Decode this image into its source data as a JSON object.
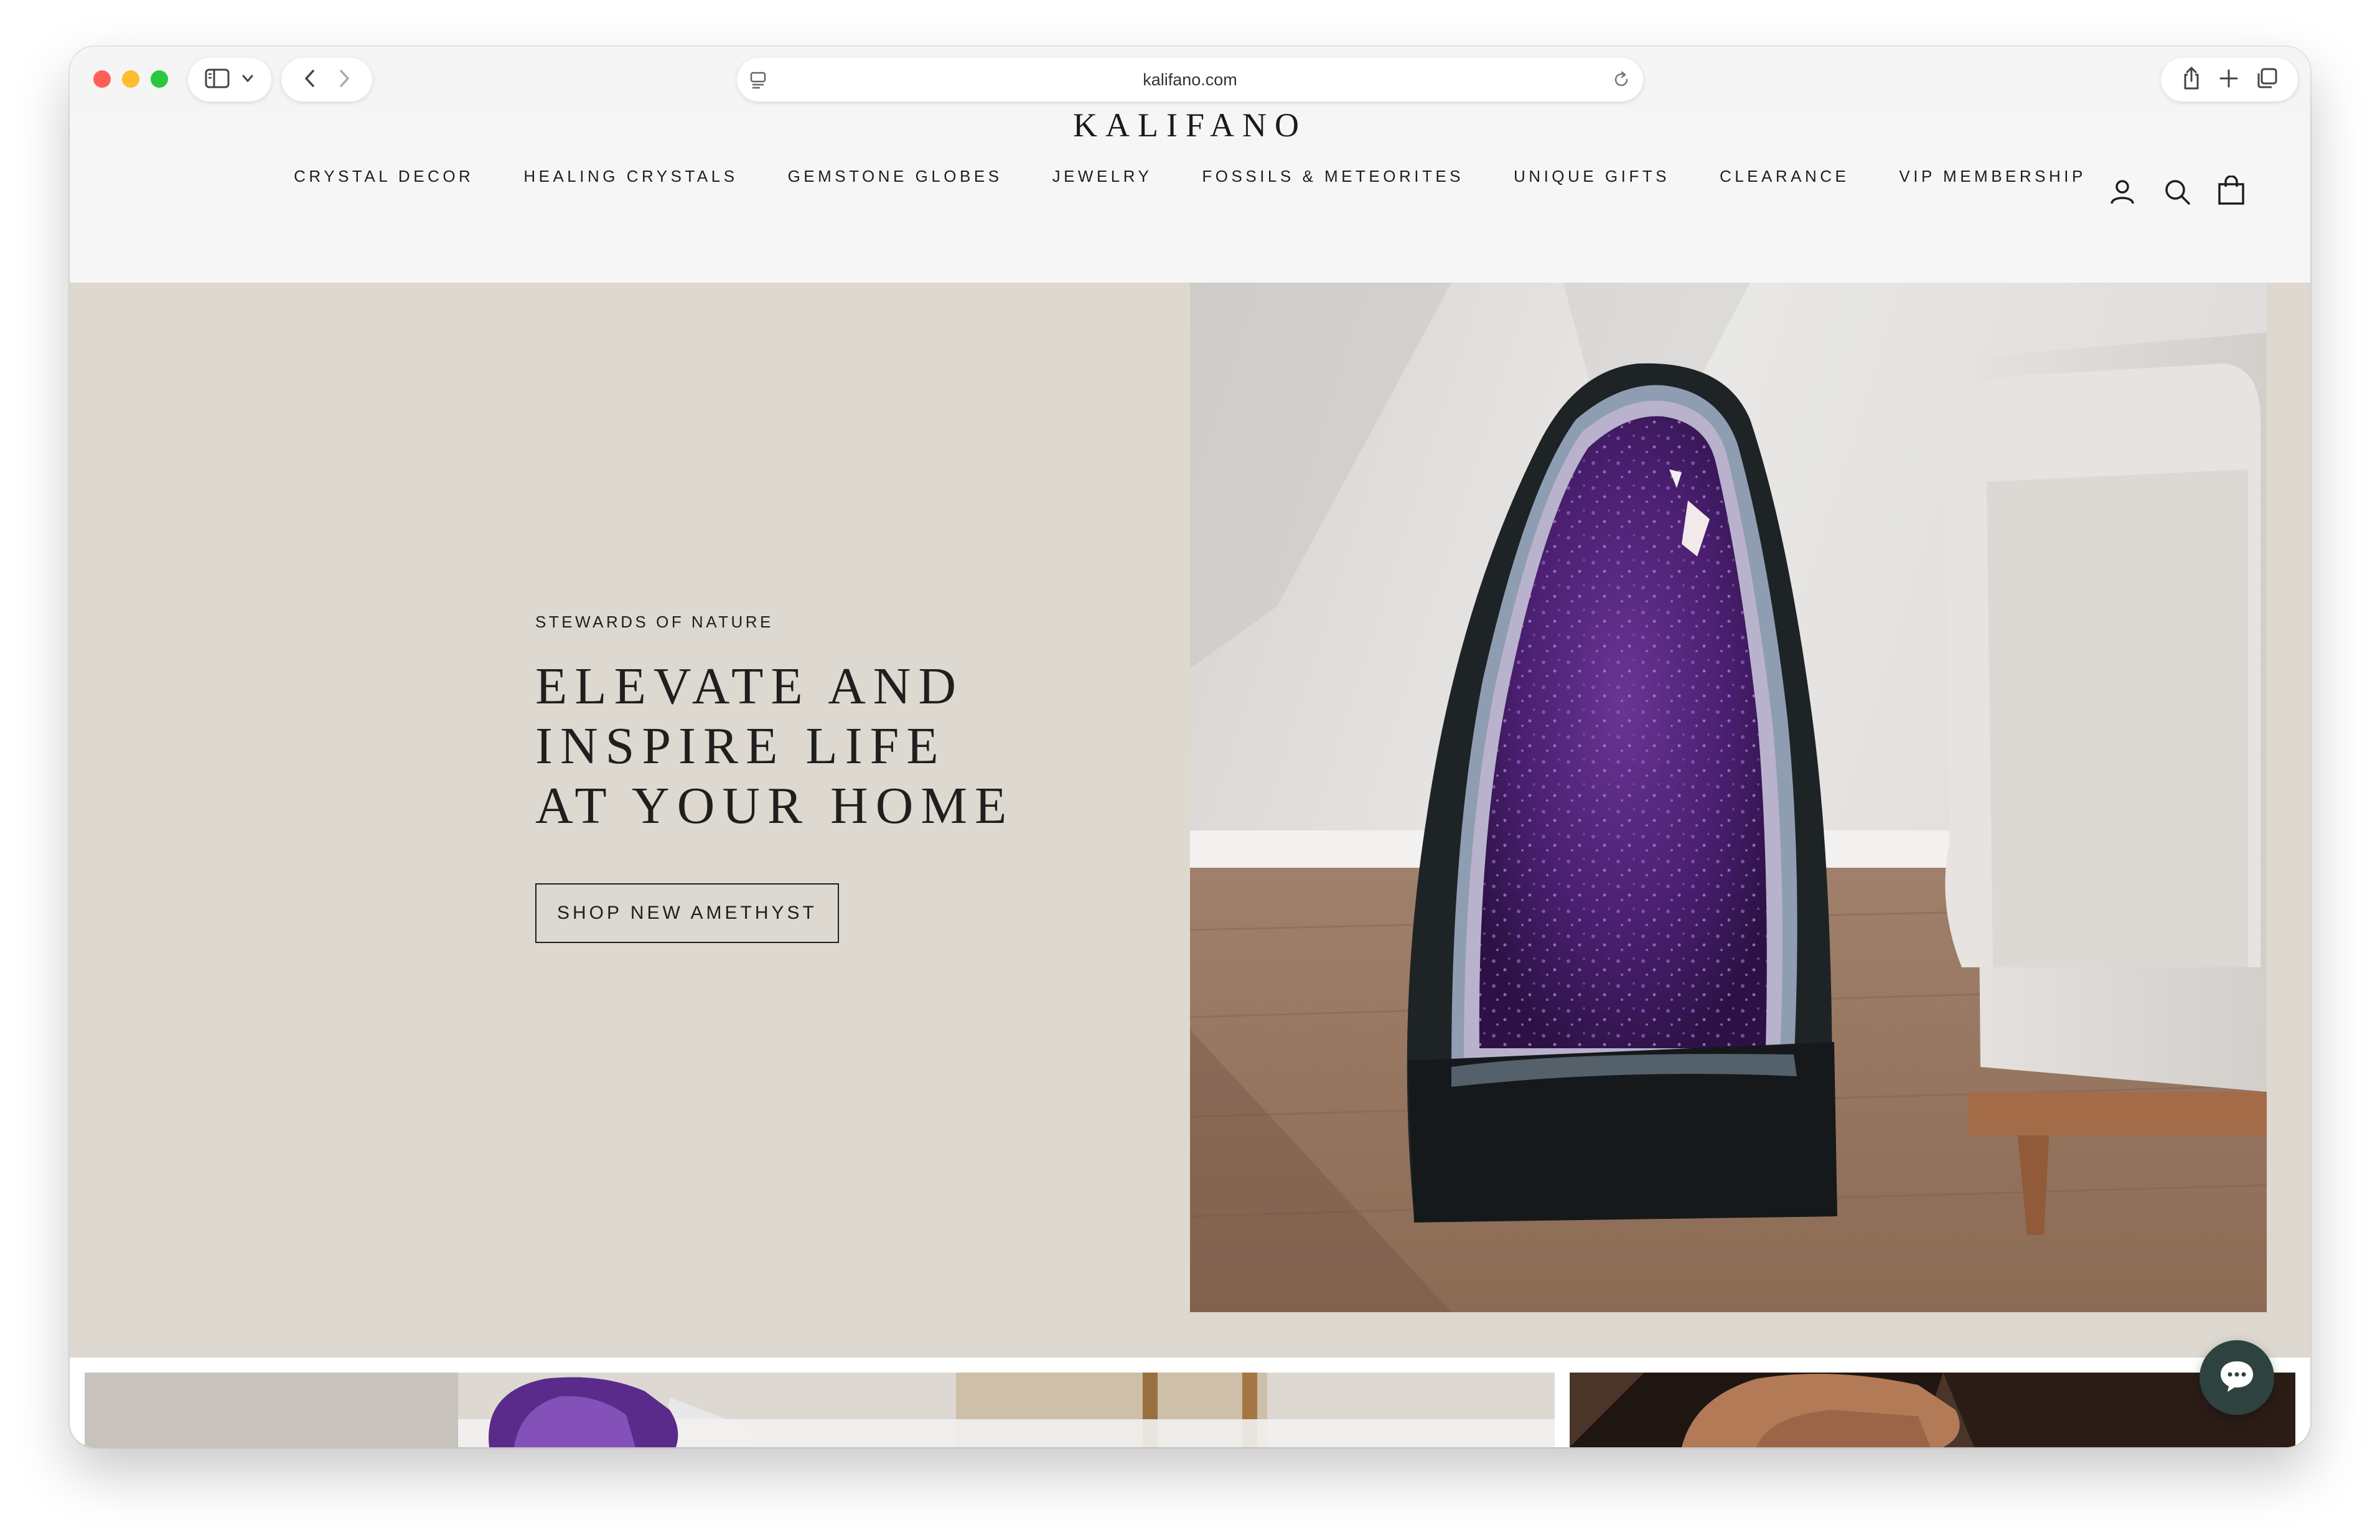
{
  "browser": {
    "url": "kalifano.com"
  },
  "site": {
    "logo": "KALIFANO",
    "nav": [
      {
        "label": "CRYSTAL DECOR"
      },
      {
        "label": "HEALING CRYSTALS"
      },
      {
        "label": "GEMSTONE GLOBES"
      },
      {
        "label": "JEWELRY"
      },
      {
        "label": "FOSSILS & METEORITES"
      },
      {
        "label": "UNIQUE GIFTS"
      },
      {
        "label": "CLEARANCE"
      },
      {
        "label": "VIP MEMBERSHIP"
      }
    ],
    "header_icons": [
      "account-icon",
      "search-icon",
      "cart-icon"
    ]
  },
  "hero": {
    "eyebrow": "STEWARDS OF NATURE",
    "title_lines": [
      "ELEVATE AND",
      "INSPIRE LIFE",
      "AT YOUR HOME"
    ],
    "cta_label": "SHOP NEW AMETHYST"
  },
  "colors": {
    "hero_bg": "#ddd9d0",
    "header_bg": "#f6f6f6",
    "chat_button": "#2e4340",
    "amethyst": "#5b2a86"
  },
  "icons": {
    "chat": "chat-bubble-icon"
  }
}
